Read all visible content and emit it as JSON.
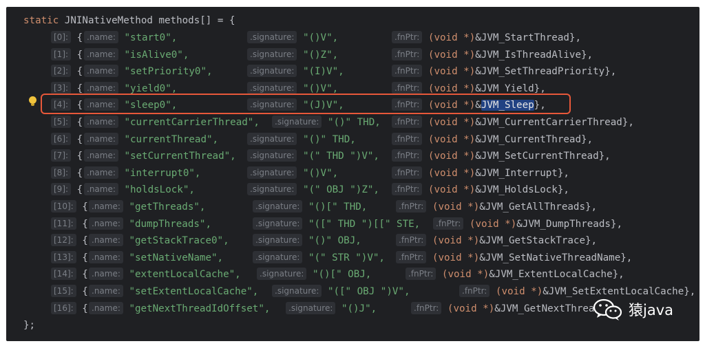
{
  "header_line": "methods[] = {",
  "header_kw": "static",
  "header_type": "JNINativeMethod",
  "closing": "};",
  "labels": {
    "name": ".name:",
    "signature": ".signature:",
    "fnPtr": ".fnPtr:"
  },
  "cast": "(void *)",
  "entries": [
    {
      "index": "[0]:",
      "name": "\"start0\",",
      "sig": "\"()V\",",
      "fn": "&JVM_StartThread},",
      "highlight": false
    },
    {
      "index": "[1]:",
      "name": "\"isAlive0\",",
      "sig": "\"()Z\",",
      "fn": "&JVM_IsThreadAlive},",
      "highlight": false
    },
    {
      "index": "[2]:",
      "name": "\"setPriority0\",",
      "sig": "\"(I)V\",",
      "fn": "&JVM_SetThreadPriority},",
      "highlight": false
    },
    {
      "index": "[3]:",
      "name": "\"yield0\",",
      "sig": "\"()V\",",
      "fn": "&JVM_Yield},",
      "highlight": false
    },
    {
      "index": "[4]:",
      "name": "\"sleep0\",",
      "sig": "\"(J)V\",",
      "fn": "&JVM_Sleep},",
      "highlight": true
    },
    {
      "index": "[5]:",
      "name": "\"currentCarrierThread\",",
      "sig": "\"()\" THD,",
      "fn": "&JVM_CurrentCarrierThread},",
      "highlight": false
    },
    {
      "index": "[6]:",
      "name": "\"currentThread\",",
      "sig": "\"()\" THD,",
      "fn": "&JVM_CurrentThread},",
      "highlight": false
    },
    {
      "index": "[7]:",
      "name": "\"setCurrentThread\",",
      "sig": "\"(\" THD \")V\",",
      "fn": "&JVM_SetCurrentThread},",
      "highlight": false
    },
    {
      "index": "[8]:",
      "name": "\"interrupt0\",",
      "sig": "\"()V\",",
      "fn": "&JVM_Interrupt},",
      "highlight": false
    },
    {
      "index": "[9]:",
      "name": "\"holdsLock\",",
      "sig": "\"(\" OBJ \")Z\",",
      "fn": "&JVM_HoldsLock},",
      "highlight": false
    },
    {
      "index": "[10]:",
      "name": "\"getThreads\",",
      "sig": "\"()[\" THD,",
      "fn": "&JVM_GetAllThreads},",
      "highlight": false
    },
    {
      "index": "[11]:",
      "name": "\"dumpThreads\",",
      "sig": "\"([\" THD \")[[\" STE,",
      "fn": "&JVM_DumpThreads},",
      "highlight": false
    },
    {
      "index": "[12]:",
      "name": "\"getStackTrace0\",",
      "sig": "\"()\" OBJ,",
      "fn": "&JVM_GetStackTrace},",
      "highlight": false
    },
    {
      "index": "[13]:",
      "name": "\"setNativeName\",",
      "sig": "\"(\" STR \")V\",",
      "fn": "&JVM_SetNativeThreadName},",
      "highlight": false
    },
    {
      "index": "[14]:",
      "name": "\"extentLocalCache\",",
      "sig": "\"()[\" OBJ,",
      "fn": "&JVM_ExtentLocalCache},",
      "highlight": false
    },
    {
      "index": "[15]:",
      "name": "\"setExtentLocalCache\",",
      "sig": "\"([\" OBJ \")V\",",
      "fn": "&JVM_SetExtentLocalCache},",
      "highlight": false
    },
    {
      "index": "[16]:",
      "name": "\"getNextThreadIdOffset\",",
      "sig": "\"()J\",",
      "fn": "&JVM_GetNextThrea",
      "highlight": false
    }
  ],
  "watermark": {
    "text": "猿java",
    "icon": "wechat-icon"
  }
}
